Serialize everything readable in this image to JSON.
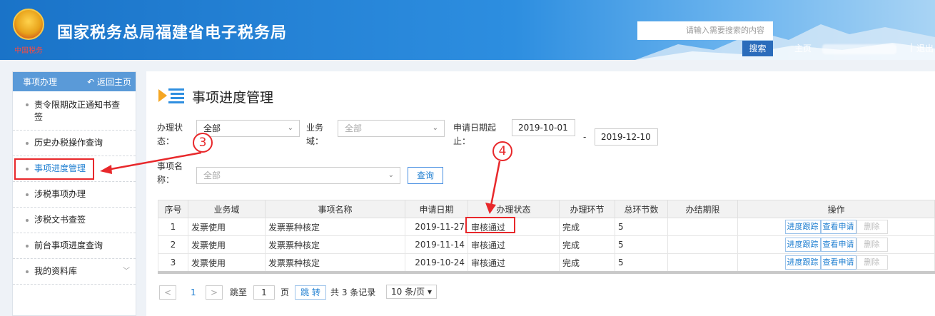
{
  "header": {
    "title": "国家税务总局福建省电子税务局",
    "emblem_text": "中国税务",
    "search_placeholder": "请输入需要搜索的内容",
    "search_button": "搜索",
    "nav_home": "主页",
    "nav_separator": "|",
    "nav_logout": "退出"
  },
  "sidebar": {
    "title": "事项办理",
    "back_label": "返回主页",
    "items": [
      {
        "label": "责令限期改正通知书查签"
      },
      {
        "label": "历史办税操作查询"
      },
      {
        "label": "事项进度管理"
      },
      {
        "label": "涉税事项办理"
      },
      {
        "label": "涉税文书查签"
      },
      {
        "label": "前台事项进度查询"
      },
      {
        "label": "我的资料库"
      }
    ]
  },
  "main": {
    "title": "事项进度管理",
    "filters": {
      "status_label": "办理状态：",
      "status_value": "全部",
      "domain_label": "业务域：",
      "domain_value": "全部",
      "date_label": "申请日期起止：",
      "date_from": "2019-10-01",
      "date_sep": "-",
      "date_to": "2019-12-10",
      "item_label": "事项名称：",
      "item_value": "全部",
      "query_button": "查询"
    },
    "table": {
      "headers": [
        "序号",
        "业务域",
        "事项名称",
        "申请日期",
        "办理状态",
        "办理环节",
        "总环节数",
        "办结期限",
        "操作"
      ],
      "rows": [
        {
          "no": "1",
          "domain": "发票使用",
          "name": "发票票种核定",
          "date": "2019-11-27",
          "status": "审核通过",
          "stage": "完成",
          "total": "5",
          "deadline": ""
        },
        {
          "no": "2",
          "domain": "发票使用",
          "name": "发票票种核定",
          "date": "2019-11-14",
          "status": "审核通过",
          "stage": "完成",
          "total": "5",
          "deadline": ""
        },
        {
          "no": "3",
          "domain": "发票使用",
          "name": "发票票种核定",
          "date": "2019-10-24",
          "status": "审核通过",
          "stage": "完成",
          "total": "5",
          "deadline": ""
        }
      ],
      "actions": {
        "track": "进度跟踪",
        "view": "查看申请",
        "delete": "删除"
      }
    },
    "pagination": {
      "prev": "<",
      "current": "1",
      "next": ">",
      "jump_label": "跳至",
      "page_input": "1",
      "page_unit": "页",
      "go_button": "跳 转",
      "total_text": "共 3 条记录",
      "page_size": "10 条/页 ▾"
    }
  },
  "annotations": {
    "marker_3": "3",
    "marker_4": "4",
    "color": "#e8282b"
  }
}
